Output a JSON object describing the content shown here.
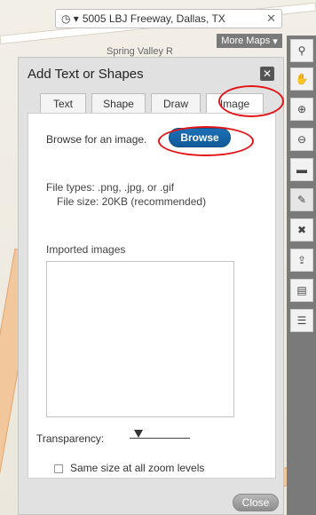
{
  "map": {
    "location": "5005 LBJ Freeway, Dallas, TX",
    "more_maps_label": "More Maps",
    "labels": [
      "Spring Valley R"
    ]
  },
  "dialog": {
    "title": "Add Text or Shapes",
    "close_x": "✕",
    "tabs": [
      {
        "label": "Text",
        "active": false
      },
      {
        "label": "Shape",
        "active": false
      },
      {
        "label": "Draw",
        "active": false
      },
      {
        "label": "Image",
        "active": true
      }
    ],
    "browse_prompt": "Browse for an image.",
    "browse_button": "Browse",
    "file_types": "File types: .png, .jpg, or .gif",
    "file_size": "File size: 20KB (recommended)",
    "imported_label": "Imported images",
    "transparency_label": "Transparency:",
    "same_size_label": "Same size at all zoom levels",
    "close_button": "Close"
  },
  "toolbar": {
    "tools": [
      "pin-icon",
      "hand-icon",
      "zoom-in-icon",
      "zoom-out-icon",
      "ruler-icon",
      "shape-icon",
      "delete-icon",
      "upload-icon",
      "pdf-icon",
      "list-icon"
    ]
  },
  "colors": {
    "accent_blue": "#1d6fb6",
    "highlight_red": "#e3151a"
  }
}
